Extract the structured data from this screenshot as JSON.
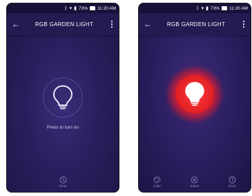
{
  "status_bar": {
    "time": "11:20 AM",
    "battery": "73%"
  },
  "screens": {
    "off": {
      "title": "RGB GARDEN LIGHT",
      "prompt": "Press to turn on",
      "nav": [
        {
          "label": "Timer",
          "icon": "clock-icon"
        }
      ]
    },
    "on": {
      "title": "RGB GARDEN LIGHT",
      "nav": [
        {
          "label": "Color",
          "icon": "palette-icon"
        },
        {
          "label": "Scene",
          "icon": "scene-icon"
        },
        {
          "label": "Timer",
          "icon": "clock-icon"
        }
      ]
    }
  },
  "colors": {
    "background": "#2a1f5e",
    "app_bar": "#231b52",
    "on_color": "#e01f24",
    "nav_icon": "#8c86c0"
  }
}
